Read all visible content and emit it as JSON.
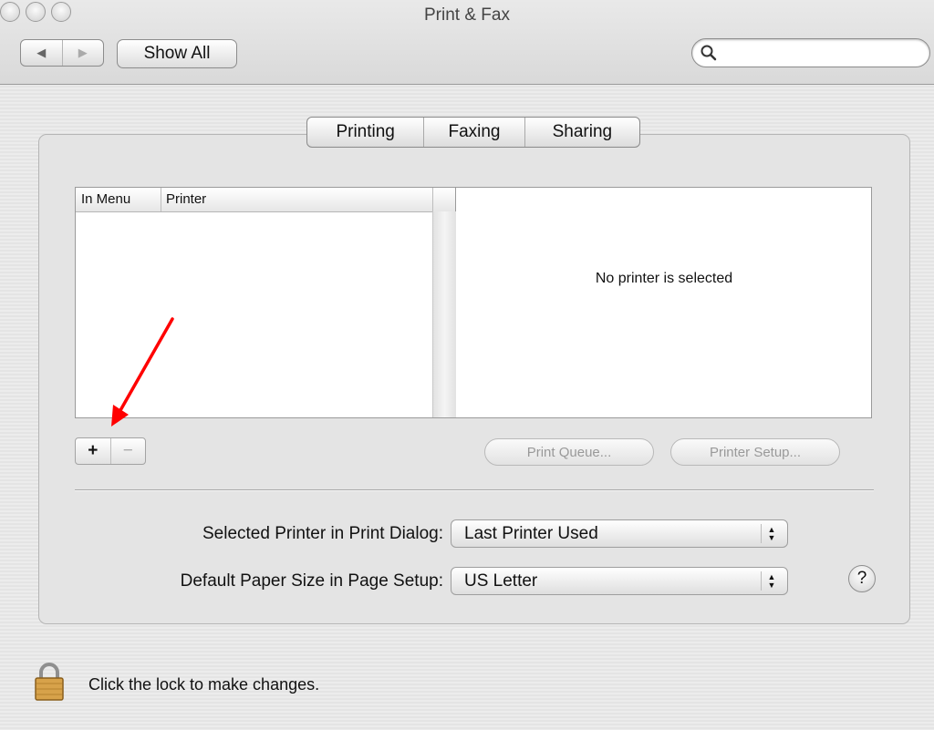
{
  "window": {
    "title": "Print & Fax"
  },
  "toolbar": {
    "back_glyph": "◀",
    "forward_glyph": "▶",
    "show_all_label": "Show All",
    "search_placeholder": ""
  },
  "tabs": [
    {
      "label": "Printing",
      "selected": true
    },
    {
      "label": "Faxing",
      "selected": false
    },
    {
      "label": "Sharing",
      "selected": false
    }
  ],
  "printer_list": {
    "columns": [
      "In Menu",
      "Printer"
    ],
    "rows": []
  },
  "detail": {
    "message": "No printer is selected"
  },
  "list_controls": {
    "add_label": "+",
    "remove_label": "−"
  },
  "buttons": {
    "print_queue": "Print Queue...",
    "printer_setup": "Printer Setup..."
  },
  "settings": {
    "selected_printer_label": "Selected Printer in Print Dialog:",
    "selected_printer_value": "Last Printer Used",
    "paper_size_label": "Default Paper Size in Page Setup:",
    "paper_size_value": "US Letter"
  },
  "help_label": "?",
  "lock_text": "Click the lock to make changes.",
  "colors": {
    "annotation_arrow": "#ff0000",
    "window_bg": "#e4e4e4"
  },
  "icons": {
    "search": "magnifier-icon",
    "lock": "lock-icon",
    "help": "question-icon"
  }
}
